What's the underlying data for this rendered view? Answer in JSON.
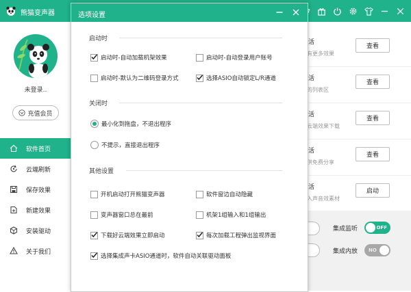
{
  "app": {
    "title": "熊猫变声器",
    "login_status": "未登录..",
    "vip_button": "充值会员",
    "nav": [
      {
        "label": "软件首页",
        "icon": "home-icon",
        "active": true
      },
      {
        "label": "云端刷新",
        "icon": "refresh-icon",
        "active": false
      },
      {
        "label": "保存效果",
        "icon": "save-icon",
        "active": false
      },
      {
        "label": "新建效果",
        "icon": "new-effect-icon",
        "active": false
      },
      {
        "label": "安装驱动",
        "icon": "install-driver-icon",
        "active": false
      },
      {
        "label": "关于我们",
        "icon": "about-icon",
        "active": false
      }
    ],
    "cards": [
      {
        "title": "活",
        "sub": "有更多效果",
        "button": "查看"
      },
      {
        "title": "活",
        "sub": "的列表区",
        "button": "查看"
      },
      {
        "title": "活",
        "sub": "云端效果下载",
        "button": "查看"
      },
      {
        "title": "活",
        "sub": "供免费分享",
        "button": "查看"
      },
      {
        "title": "活",
        "sub": "入声音效素材",
        "button": "启动"
      }
    ],
    "toggles": [
      {
        "label": "集成监听",
        "state": "OFF",
        "on": true
      },
      {
        "label": "集成内放",
        "state": "NO",
        "on": false
      }
    ],
    "accent_color": "#20b28a"
  },
  "dialog": {
    "title": "选项设置",
    "sections": {
      "startup": {
        "title": "启动时",
        "options": [
          {
            "label": "启动时-自动加载机架效果",
            "checked": true
          },
          {
            "label": "启动时-自动登录用户账号",
            "checked": false
          },
          {
            "label": "启动时-默认为二维码登录方式",
            "checked": false
          },
          {
            "label": "选择ASIO自动锁定L/R通道",
            "checked": true
          }
        ]
      },
      "close": {
        "title": "关闭时",
        "options": [
          {
            "label": "最小化到拖盘，不退出程序",
            "selected": true
          },
          {
            "label": "不提示，直接退出程序",
            "selected": false
          }
        ]
      },
      "other": {
        "title": "其他设置",
        "options": [
          {
            "label": "开机启动打开熊猫变声器",
            "checked": false
          },
          {
            "label": "软件窗边自动隐藏",
            "checked": false
          },
          {
            "label": "变声器窗口总在最前",
            "checked": false
          },
          {
            "label": "机架1组输入和1组输出",
            "checked": false
          },
          {
            "label": "下载好云端效果立即启动",
            "checked": true
          },
          {
            "label": "每次加载工程弹出监视界面",
            "checked": true
          },
          {
            "label": "选择集成声卡ASIO通道时，软件自动关联驱动面板",
            "checked": true
          }
        ]
      }
    }
  }
}
